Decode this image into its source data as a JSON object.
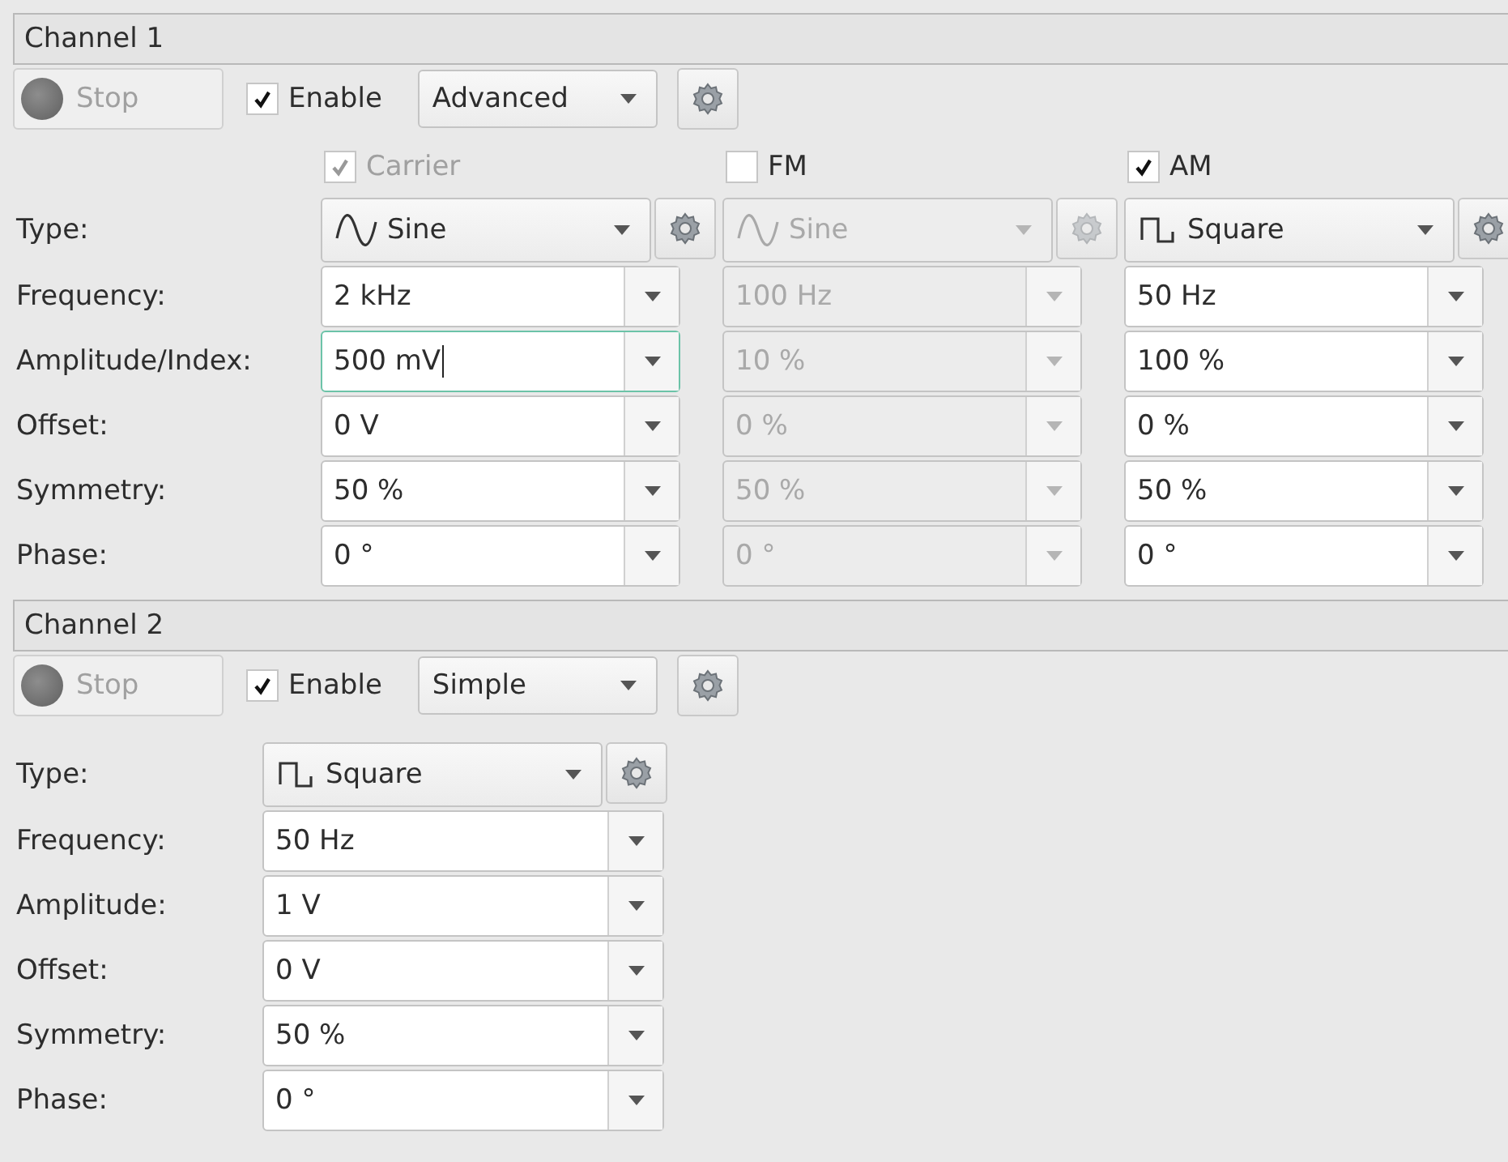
{
  "channels": [
    {
      "title": "Channel 1",
      "kind": "advanced",
      "stop": {
        "label": "Stop",
        "disabled": true
      },
      "enable": {
        "label": "Enable",
        "checked": true
      },
      "mode": "Advanced",
      "row_labels": [
        "Type:",
        "Frequency:",
        "Amplitude/Index:",
        "Offset:",
        "Symmetry:",
        "Phase:"
      ],
      "columns": [
        {
          "header": {
            "label": "Carrier",
            "checked": true,
            "disabled": true
          },
          "disabled": false,
          "type": {
            "kind": "sine",
            "label": "Sine"
          },
          "fields": [
            {
              "value": "2 kHz",
              "focused": false
            },
            {
              "value": "500 mV",
              "focused": true
            },
            {
              "value": "0 V",
              "focused": false
            },
            {
              "value": "50 %",
              "focused": false
            },
            {
              "value": "0 °",
              "focused": false
            }
          ]
        },
        {
          "header": {
            "label": "FM",
            "checked": false,
            "disabled": false
          },
          "disabled": true,
          "type": {
            "kind": "sine",
            "label": "Sine"
          },
          "fields": [
            {
              "value": "100 Hz",
              "focused": false
            },
            {
              "value": "10 %",
              "focused": false
            },
            {
              "value": "0 %",
              "focused": false
            },
            {
              "value": "50 %",
              "focused": false
            },
            {
              "value": "0 °",
              "focused": false
            }
          ]
        },
        {
          "header": {
            "label": "AM",
            "checked": true,
            "disabled": false
          },
          "disabled": false,
          "type": {
            "kind": "square",
            "label": "Square"
          },
          "fields": [
            {
              "value": "50 Hz",
              "focused": false
            },
            {
              "value": "100 %",
              "focused": false
            },
            {
              "value": "0 %",
              "focused": false
            },
            {
              "value": "50 %",
              "focused": false
            },
            {
              "value": "0 °",
              "focused": false
            }
          ]
        }
      ]
    },
    {
      "title": "Channel 2",
      "kind": "simple",
      "stop": {
        "label": "Stop",
        "disabled": true
      },
      "enable": {
        "label": "Enable",
        "checked": true
      },
      "mode": "Simple",
      "row_labels": [
        "Type:",
        "Frequency:",
        "Amplitude:",
        "Offset:",
        "Symmetry:",
        "Phase:"
      ],
      "columns": [
        {
          "disabled": false,
          "type": {
            "kind": "square",
            "label": "Square"
          },
          "fields": [
            {
              "value": "50 Hz",
              "focused": false
            },
            {
              "value": "1 V",
              "focused": false
            },
            {
              "value": "0 V",
              "focused": false
            },
            {
              "value": "50 %",
              "focused": false
            },
            {
              "value": "0 °",
              "focused": false
            }
          ]
        }
      ]
    }
  ]
}
